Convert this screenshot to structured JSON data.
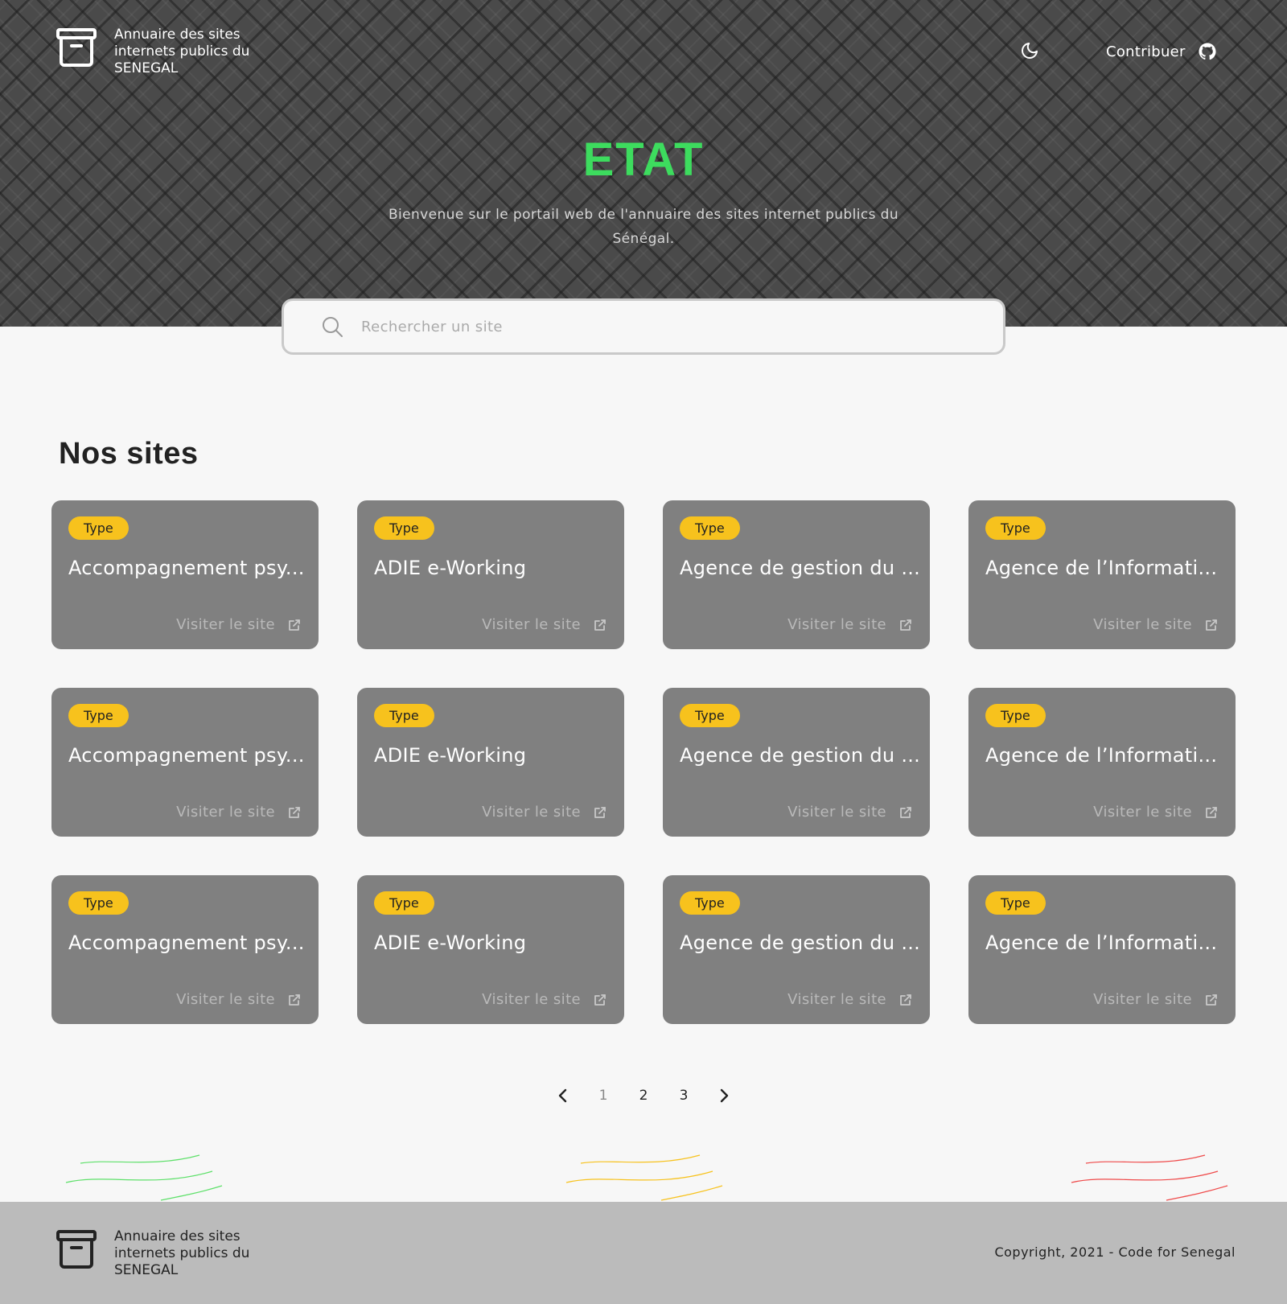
{
  "header": {
    "brand_text": "Annuaire des sites internets publics du SENEGAL",
    "contribute_label": "Contribuer",
    "icons": {
      "brand": "archive-box-icon",
      "theme": "moon-icon",
      "github": "github-icon"
    }
  },
  "hero": {
    "title": "ETAT",
    "subtitle": "Bienvenue sur le portail web de l'annuaire des sites internet publics du Sénégal.",
    "title_color": "#3ddc5e"
  },
  "search": {
    "placeholder": "Rechercher un site",
    "value": ""
  },
  "sites": {
    "heading": "Nos sites",
    "visit_label": "Visiter le site",
    "badge_color": "#f7c21d",
    "cards": [
      {
        "type": "Type",
        "title": "Accompagnement psy..."
      },
      {
        "type": "Type",
        "title": "ADIE e-Working"
      },
      {
        "type": "Type",
        "title": "Agence de gestion du ..."
      },
      {
        "type": "Type",
        "title": "Agence de l’Informati..."
      },
      {
        "type": "Type",
        "title": "Accompagnement psy..."
      },
      {
        "type": "Type",
        "title": "ADIE e-Working"
      },
      {
        "type": "Type",
        "title": "Agence de gestion du ..."
      },
      {
        "type": "Type",
        "title": "Agence de l’Informati..."
      },
      {
        "type": "Type",
        "title": "Accompagnement psy..."
      },
      {
        "type": "Type",
        "title": "ADIE e-Working"
      },
      {
        "type": "Type",
        "title": "Agence de gestion du ..."
      },
      {
        "type": "Type",
        "title": "Agence de l’Informati..."
      }
    ]
  },
  "pagination": {
    "pages": [
      "1",
      "2",
      "3"
    ],
    "current": "1"
  },
  "decorations": {
    "wave_colors": [
      "#5ee06a",
      "#f7c21d",
      "#ef4a4a"
    ]
  },
  "footer": {
    "brand_text": "Annuaire des sites internets publics du SENEGAL",
    "copyright": "Copyright, 2021 - Code for Senegal"
  }
}
